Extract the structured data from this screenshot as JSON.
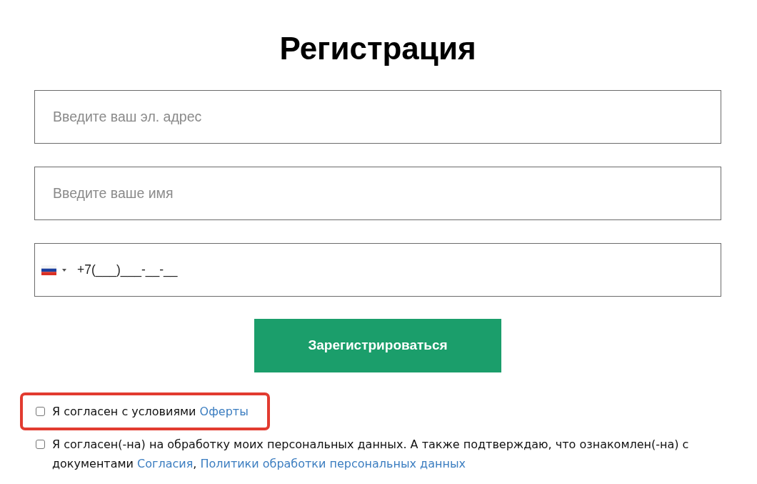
{
  "title": "Регистрация",
  "fields": [
    {
      "kind": "email",
      "placeholder": "Введите ваш эл. адрес"
    },
    {
      "kind": "name",
      "placeholder": "Введите ваше имя"
    },
    {
      "kind": "phone",
      "value": "+7(___)___-__-__"
    }
  ],
  "submit_button": {
    "label": "Зарегистрироваться"
  },
  "consents": [
    {
      "checked": false,
      "highlighted": true,
      "segments": [
        {
          "kind": "text",
          "text": "Я согласен с условиями "
        },
        {
          "kind": "link",
          "text": "Оферты"
        }
      ]
    },
    {
      "checked": false,
      "highlighted": false,
      "segments": [
        {
          "kind": "text",
          "text": "Я согласен(-на) на обработку моих персональных данных. А также подтверждаю, что ознакомлен(-на) с документами "
        },
        {
          "kind": "link",
          "text": "Согласия"
        },
        {
          "kind": "text",
          "text": ", "
        },
        {
          "kind": "link",
          "text": "Политики обработки персональных данных"
        }
      ]
    }
  ]
}
